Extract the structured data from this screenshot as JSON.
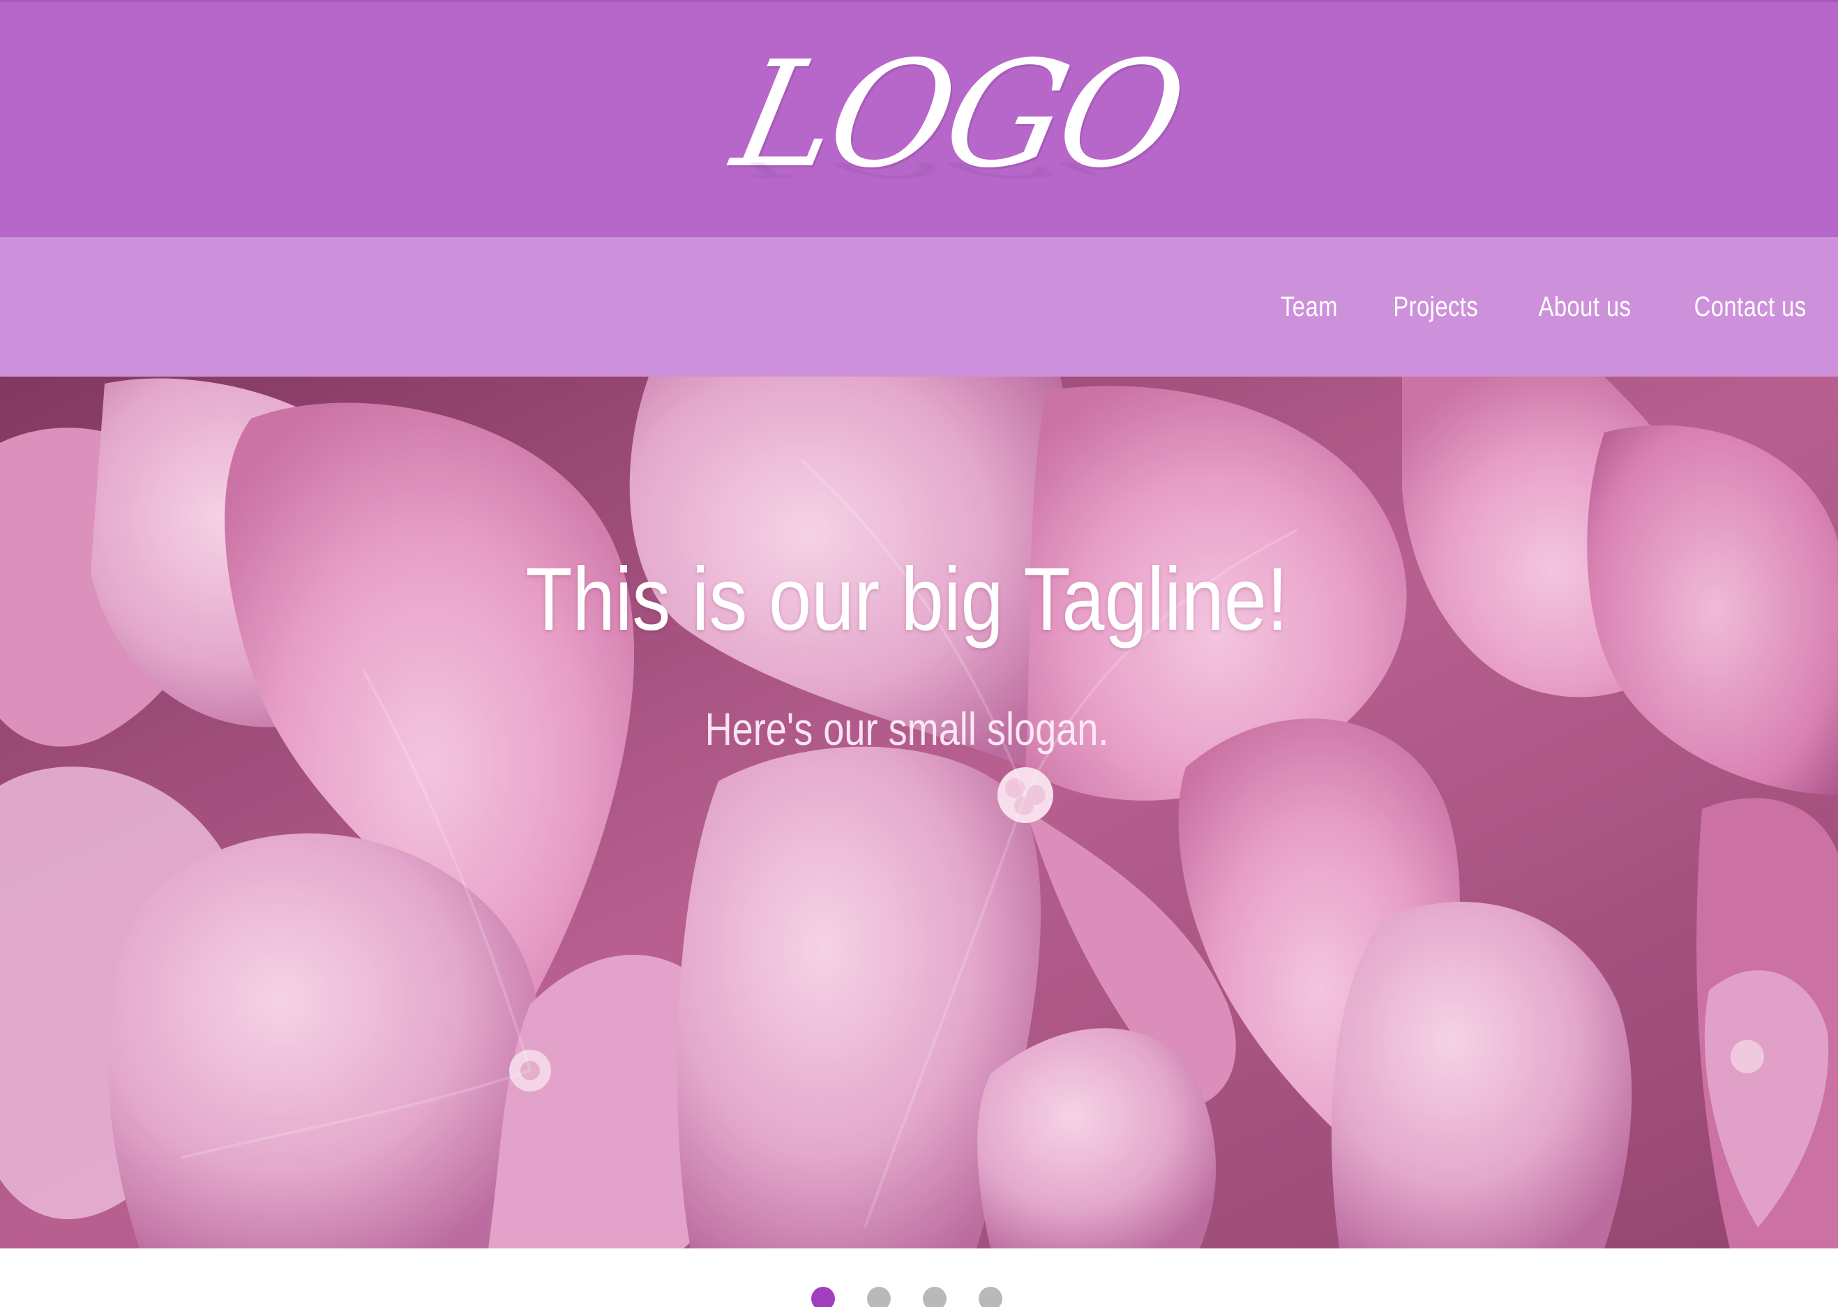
{
  "header": {
    "logo_text": "LOGO",
    "background_color": "#b767c9"
  },
  "nav": {
    "background_color": "#cd90db",
    "items": [
      {
        "label": "Team"
      },
      {
        "label": "Projects"
      },
      {
        "label": "About us"
      },
      {
        "label": "Contact us"
      }
    ]
  },
  "hero": {
    "tagline": "This is our big Tagline!",
    "slogan": "Here's our small slogan.",
    "image_description_icon": "pink-hydrangea-flower-image"
  },
  "carousel": {
    "slide_count": 4,
    "active_index": 0,
    "active_color": "#a13fbf",
    "inactive_color": "#b9b9b9"
  }
}
